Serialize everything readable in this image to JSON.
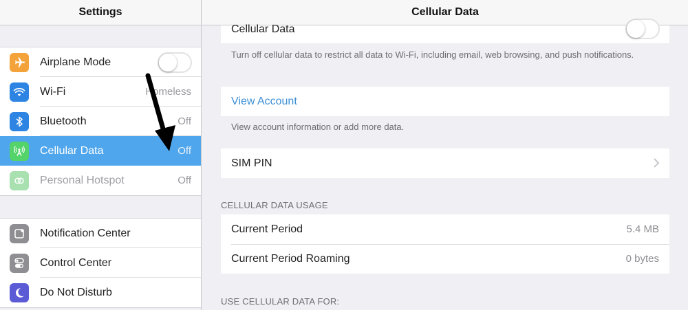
{
  "sidebar": {
    "title": "Settings",
    "group1": [
      {
        "label": "Airplane Mode",
        "icon": "airplane-icon",
        "icon_color": "#f3a33a",
        "value": "",
        "toggle": false
      },
      {
        "label": "Wi-Fi",
        "icon": "wifi-icon",
        "icon_color": "#2d84e3",
        "value": "Homeless"
      },
      {
        "label": "Bluetooth",
        "icon": "bluetooth-icon",
        "icon_color": "#2d84e3",
        "value": "Off"
      },
      {
        "label": "Cellular Data",
        "icon": "cellular-icon",
        "icon_color": "#53d36a",
        "value": "Off",
        "selected": true
      },
      {
        "label": "Personal Hotspot",
        "icon": "hotspot-icon",
        "icon_color": "#a8e0b0",
        "value": "Off",
        "disabled": true
      }
    ],
    "group2": [
      {
        "label": "Notification Center",
        "icon": "notification-center-icon",
        "icon_color": "#8e8e93"
      },
      {
        "label": "Control Center",
        "icon": "control-center-icon",
        "icon_color": "#8e8e93"
      },
      {
        "label": "Do Not Disturb",
        "icon": "moon-icon",
        "icon_color": "#5c5bd6"
      }
    ]
  },
  "main": {
    "title": "Cellular Data",
    "cellular_toggle": {
      "label": "Cellular Data",
      "on": false
    },
    "cellular_footnote": "Turn off cellular data to restrict all data to Wi-Fi, including email, web browsing, and push notifications.",
    "view_account": {
      "label": "View Account"
    },
    "view_account_footnote": "View account information or add more data.",
    "sim_pin": {
      "label": "SIM PIN"
    },
    "usage_header": "CELLULAR DATA USAGE",
    "usage_rows": [
      {
        "label": "Current Period",
        "value": "5.4 MB"
      },
      {
        "label": "Current Period Roaming",
        "value": "0 bytes"
      }
    ],
    "use_for_header": "USE CELLULAR DATA FOR:"
  },
  "colors": {
    "selection": "#4fa6ec",
    "link": "#3c8fd6",
    "background": "#efeff4"
  }
}
